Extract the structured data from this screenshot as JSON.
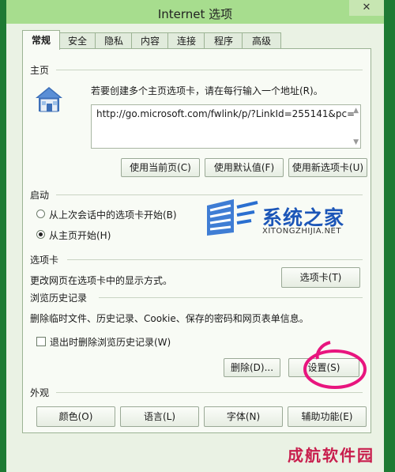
{
  "window": {
    "title": "Internet 选项",
    "close_glyph": "✕"
  },
  "tabs": [
    "常规",
    "安全",
    "隐私",
    "内容",
    "连接",
    "程序",
    "高级"
  ],
  "homepage": {
    "section_title": "主页",
    "instruction": "若要创建多个主页选项卡，请在每行输入一个地址(R)。",
    "url": "http://go.microsoft.com/fwlink/p/?LinkId=255141&pc=",
    "buttons": [
      "使用当前页(C)",
      "使用默认值(F)",
      "使用新选项卡(U)"
    ]
  },
  "startup": {
    "section_title": "启动",
    "options": [
      "从上次会话中的选项卡开始(B)",
      "从主页开始(H)"
    ],
    "selected_index": 1
  },
  "tabs_section": {
    "section_title": "选项卡",
    "description": "更改网页在选项卡中的显示方式。",
    "button": "选项卡(T)"
  },
  "history": {
    "section_title": "浏览历史记录",
    "description": "删除临时文件、历史记录、Cookie、保存的密码和网页表单信息。",
    "checkbox_label": "退出时删除浏览历史记录(W)",
    "delete_button": "删除(D)...",
    "settings_button": "设置(S)",
    "annotation": "6"
  },
  "appearance": {
    "section_title": "外观",
    "buttons": [
      "颜色(O)",
      "语言(L)",
      "字体(N)",
      "辅助功能(E)"
    ]
  },
  "watermark": {
    "name_cn": "系统之家",
    "name_en": "XITONGZHIJIA.NET",
    "bottom_text": "成航软件园"
  },
  "colors": {
    "title_bar": "#a7dd8e",
    "annotation": "#e8157e",
    "watermark_blue": "#1c56b8",
    "watermark_red": "#c81e4d"
  },
  "icons": [
    "house-icon",
    "close-icon",
    "logo-icon"
  ]
}
